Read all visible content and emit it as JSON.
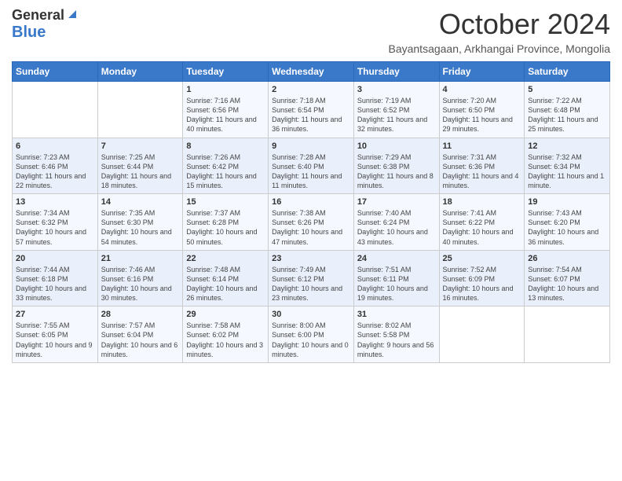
{
  "header": {
    "logo_line1": "General",
    "logo_line2": "Blue",
    "month": "October 2024",
    "location": "Bayantsagaan, Arkhangai Province, Mongolia"
  },
  "days_of_week": [
    "Sunday",
    "Monday",
    "Tuesday",
    "Wednesday",
    "Thursday",
    "Friday",
    "Saturday"
  ],
  "weeks": [
    [
      {
        "day": "",
        "content": ""
      },
      {
        "day": "",
        "content": ""
      },
      {
        "day": "1",
        "content": "Sunrise: 7:16 AM\nSunset: 6:56 PM\nDaylight: 11 hours and 40 minutes."
      },
      {
        "day": "2",
        "content": "Sunrise: 7:18 AM\nSunset: 6:54 PM\nDaylight: 11 hours and 36 minutes."
      },
      {
        "day": "3",
        "content": "Sunrise: 7:19 AM\nSunset: 6:52 PM\nDaylight: 11 hours and 32 minutes."
      },
      {
        "day": "4",
        "content": "Sunrise: 7:20 AM\nSunset: 6:50 PM\nDaylight: 11 hours and 29 minutes."
      },
      {
        "day": "5",
        "content": "Sunrise: 7:22 AM\nSunset: 6:48 PM\nDaylight: 11 hours and 25 minutes."
      }
    ],
    [
      {
        "day": "6",
        "content": "Sunrise: 7:23 AM\nSunset: 6:46 PM\nDaylight: 11 hours and 22 minutes."
      },
      {
        "day": "7",
        "content": "Sunrise: 7:25 AM\nSunset: 6:44 PM\nDaylight: 11 hours and 18 minutes."
      },
      {
        "day": "8",
        "content": "Sunrise: 7:26 AM\nSunset: 6:42 PM\nDaylight: 11 hours and 15 minutes."
      },
      {
        "day": "9",
        "content": "Sunrise: 7:28 AM\nSunset: 6:40 PM\nDaylight: 11 hours and 11 minutes."
      },
      {
        "day": "10",
        "content": "Sunrise: 7:29 AM\nSunset: 6:38 PM\nDaylight: 11 hours and 8 minutes."
      },
      {
        "day": "11",
        "content": "Sunrise: 7:31 AM\nSunset: 6:36 PM\nDaylight: 11 hours and 4 minutes."
      },
      {
        "day": "12",
        "content": "Sunrise: 7:32 AM\nSunset: 6:34 PM\nDaylight: 11 hours and 1 minute."
      }
    ],
    [
      {
        "day": "13",
        "content": "Sunrise: 7:34 AM\nSunset: 6:32 PM\nDaylight: 10 hours and 57 minutes."
      },
      {
        "day": "14",
        "content": "Sunrise: 7:35 AM\nSunset: 6:30 PM\nDaylight: 10 hours and 54 minutes."
      },
      {
        "day": "15",
        "content": "Sunrise: 7:37 AM\nSunset: 6:28 PM\nDaylight: 10 hours and 50 minutes."
      },
      {
        "day": "16",
        "content": "Sunrise: 7:38 AM\nSunset: 6:26 PM\nDaylight: 10 hours and 47 minutes."
      },
      {
        "day": "17",
        "content": "Sunrise: 7:40 AM\nSunset: 6:24 PM\nDaylight: 10 hours and 43 minutes."
      },
      {
        "day": "18",
        "content": "Sunrise: 7:41 AM\nSunset: 6:22 PM\nDaylight: 10 hours and 40 minutes."
      },
      {
        "day": "19",
        "content": "Sunrise: 7:43 AM\nSunset: 6:20 PM\nDaylight: 10 hours and 36 minutes."
      }
    ],
    [
      {
        "day": "20",
        "content": "Sunrise: 7:44 AM\nSunset: 6:18 PM\nDaylight: 10 hours and 33 minutes."
      },
      {
        "day": "21",
        "content": "Sunrise: 7:46 AM\nSunset: 6:16 PM\nDaylight: 10 hours and 30 minutes."
      },
      {
        "day": "22",
        "content": "Sunrise: 7:48 AM\nSunset: 6:14 PM\nDaylight: 10 hours and 26 minutes."
      },
      {
        "day": "23",
        "content": "Sunrise: 7:49 AM\nSunset: 6:12 PM\nDaylight: 10 hours and 23 minutes."
      },
      {
        "day": "24",
        "content": "Sunrise: 7:51 AM\nSunset: 6:11 PM\nDaylight: 10 hours and 19 minutes."
      },
      {
        "day": "25",
        "content": "Sunrise: 7:52 AM\nSunset: 6:09 PM\nDaylight: 10 hours and 16 minutes."
      },
      {
        "day": "26",
        "content": "Sunrise: 7:54 AM\nSunset: 6:07 PM\nDaylight: 10 hours and 13 minutes."
      }
    ],
    [
      {
        "day": "27",
        "content": "Sunrise: 7:55 AM\nSunset: 6:05 PM\nDaylight: 10 hours and 9 minutes."
      },
      {
        "day": "28",
        "content": "Sunrise: 7:57 AM\nSunset: 6:04 PM\nDaylight: 10 hours and 6 minutes."
      },
      {
        "day": "29",
        "content": "Sunrise: 7:58 AM\nSunset: 6:02 PM\nDaylight: 10 hours and 3 minutes."
      },
      {
        "day": "30",
        "content": "Sunrise: 8:00 AM\nSunset: 6:00 PM\nDaylight: 10 hours and 0 minutes."
      },
      {
        "day": "31",
        "content": "Sunrise: 8:02 AM\nSunset: 5:58 PM\nDaylight: 9 hours and 56 minutes."
      },
      {
        "day": "",
        "content": ""
      },
      {
        "day": "",
        "content": ""
      }
    ]
  ]
}
